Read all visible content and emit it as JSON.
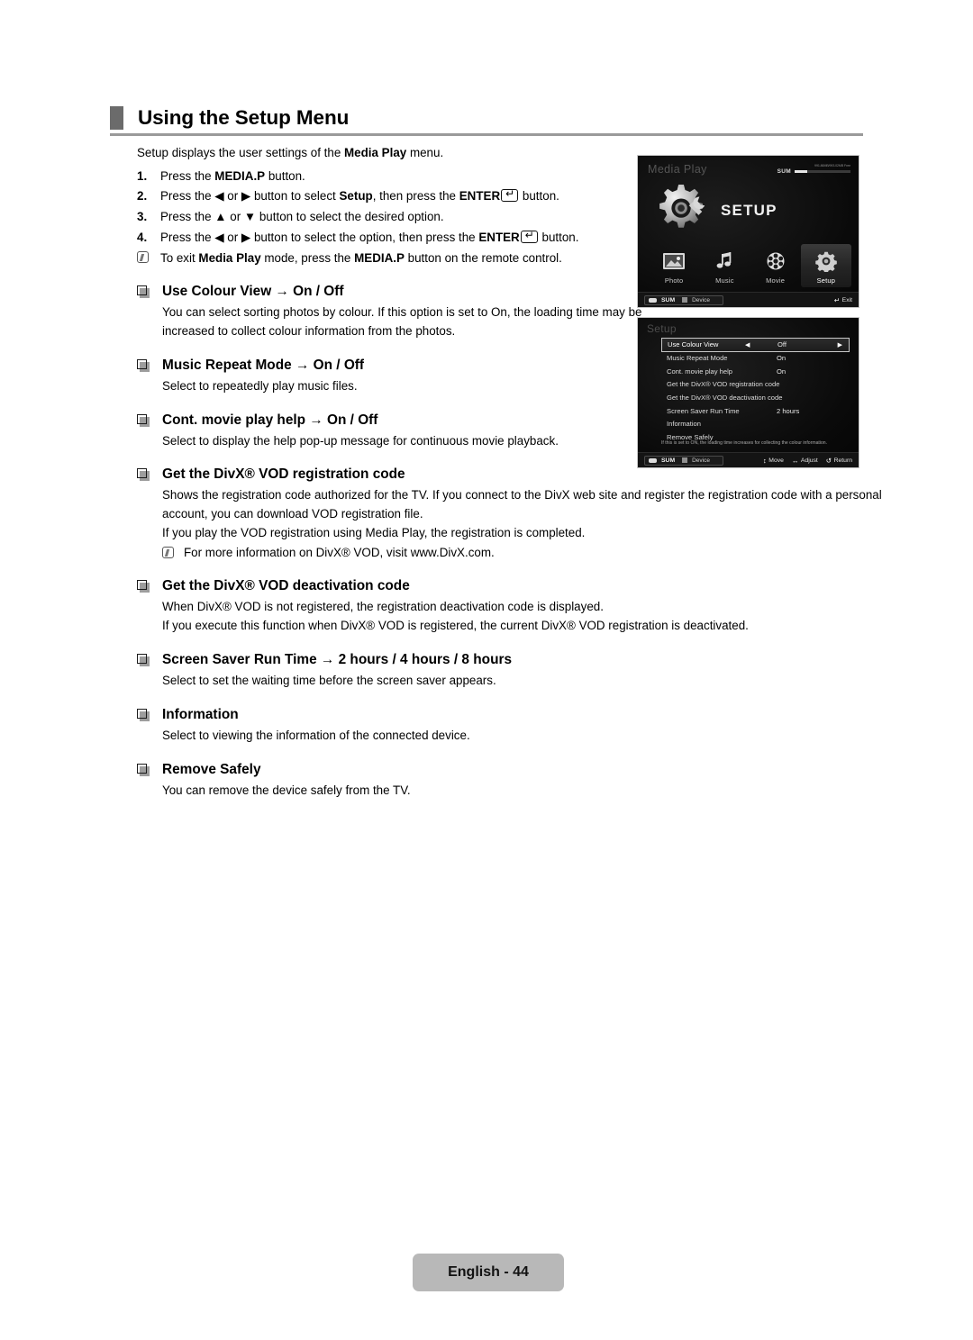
{
  "page": {
    "title": "Using the Setup Menu",
    "footer_label": "English - 44"
  },
  "intro": {
    "before": "Setup displays the user settings of the ",
    "bold": "Media Play",
    "after": " menu."
  },
  "steps": [
    {
      "num": "1.",
      "parts": [
        {
          "t": "Press the ",
          "b": false
        },
        {
          "t": "MEDIA.P",
          "b": true
        },
        {
          "t": " button.",
          "b": false
        }
      ]
    },
    {
      "num": "2.",
      "parts": [
        {
          "t": "Press the ◀ or ▶ button to select ",
          "b": false
        },
        {
          "t": "Setup",
          "b": true
        },
        {
          "t": ", then press the ",
          "b": false
        },
        {
          "t": "ENTER",
          "b": true
        },
        {
          "t": "__ENTERKEY__",
          "b": false
        },
        {
          "t": " button.",
          "b": false
        }
      ]
    },
    {
      "num": "3.",
      "parts": [
        {
          "t": "Press the ▲ or ▼ button to select the desired option.",
          "b": false
        }
      ]
    },
    {
      "num": "4.",
      "parts": [
        {
          "t": "Press the ◀ or ▶ button to select the option, then press the ",
          "b": false
        },
        {
          "t": "ENTER",
          "b": true
        },
        {
          "t": "__ENTERKEY__",
          "b": false
        },
        {
          "t": " button.",
          "b": false
        }
      ]
    }
  ],
  "step_note": {
    "parts": [
      {
        "t": "To exit ",
        "b": false
      },
      {
        "t": "Media Play",
        "b": true
      },
      {
        "t": " mode, press the ",
        "b": false
      },
      {
        "t": "MEDIA.P",
        "b": true
      },
      {
        "t": " button on the remote control.",
        "b": false
      }
    ]
  },
  "sections": [
    {
      "heading": "Use Colour View → On / Off",
      "width": "narrow",
      "paragraphs": [
        "You can select sorting photos by colour. If this option is set to On, the loading time may be increased to collect colour information from the photos."
      ],
      "notes": []
    },
    {
      "heading": "Music Repeat Mode → On / Off",
      "width": "narrow",
      "paragraphs": [
        "Select to repeatedly play music files."
      ],
      "notes": []
    },
    {
      "heading": "Cont. movie play help → On / Off",
      "width": "narrow",
      "paragraphs": [
        "Select to display the help pop-up message for continuous movie playback."
      ],
      "notes": []
    },
    {
      "heading": "Get the DivX® VOD registration code",
      "width": "wide",
      "paragraphs": [
        "Shows the registration code authorized for the TV. If you connect to the DivX web site and register the registration code with a personal account, you can download VOD registration file.",
        "If you play the VOD registration using Media Play, the registration is completed."
      ],
      "notes": [
        "For more information on DivX® VOD, visit www.DivX.com."
      ]
    },
    {
      "heading": "Get the DivX® VOD deactivation code",
      "width": "wide",
      "paragraphs": [
        "When DivX® VOD is not registered, the registration deactivation code is displayed.",
        "If you execute this function when DivX® VOD is registered, the current DivX® VOD registration is deactivated."
      ],
      "notes": []
    },
    {
      "heading": "Screen Saver Run Time → 2 hours / 4 hours / 8 hours",
      "width": "narrow",
      "paragraphs": [
        "Select to set the waiting time before the screen saver appears."
      ],
      "notes": []
    },
    {
      "heading": "Information",
      "width": "narrow",
      "paragraphs": [
        "Select to viewing the information of the connected device."
      ],
      "notes": []
    },
    {
      "heading": "Remove Safely",
      "width": "narrow",
      "paragraphs": [
        "You can remove the device safely from the TV."
      ],
      "notes": []
    }
  ],
  "tv_media_play": {
    "title": "Media Play",
    "storage_label": "SUM",
    "storage_caption": "991.86MB/993.02MB Free",
    "hero_label": "SETUP",
    "icons": [
      {
        "caption": "Photo",
        "icon": "photo-icon",
        "active": false
      },
      {
        "caption": "Music",
        "icon": "music-note-icon",
        "active": false
      },
      {
        "caption": "Movie",
        "icon": "film-reel-icon",
        "active": false
      },
      {
        "caption": "Setup",
        "icon": "gear-icon",
        "active": true
      }
    ],
    "bar": {
      "source_label": "SUM",
      "device_label": "Device",
      "right_items": [
        {
          "glyph": "↵",
          "label": "Exit"
        }
      ]
    }
  },
  "tv_setup_menu": {
    "title": "Setup",
    "rows": [
      {
        "label": "Use Colour View",
        "value": "Off",
        "selected": true,
        "arrows": true
      },
      {
        "label": "Music Repeat Mode",
        "value": "On",
        "selected": false,
        "arrows": false
      },
      {
        "label": "Cont. movie play help",
        "value": "On",
        "selected": false,
        "arrows": false
      },
      {
        "label": "Get the  DivX® VOD registration code",
        "value": "",
        "selected": false,
        "arrows": false
      },
      {
        "label": "Get the DivX® VOD deactivation code",
        "value": "",
        "selected": false,
        "arrows": false
      },
      {
        "label": "Screen Saver Run Time",
        "value": "2 hours",
        "selected": false,
        "arrows": false
      },
      {
        "label": "Information",
        "value": "",
        "selected": false,
        "arrows": false
      },
      {
        "label": "Remove Safely",
        "value": "",
        "selected": false,
        "arrows": false
      }
    ],
    "help_text": "If this is set to ON, the loading time increases for collecting the colour information.",
    "bar": {
      "source_label": "SUM",
      "device_label": "Device",
      "right_items": [
        {
          "glyph": "↕",
          "label": "Move"
        },
        {
          "glyph": "↔",
          "label": "Adjust"
        },
        {
          "glyph": "↺",
          "label": "Return"
        }
      ]
    }
  }
}
